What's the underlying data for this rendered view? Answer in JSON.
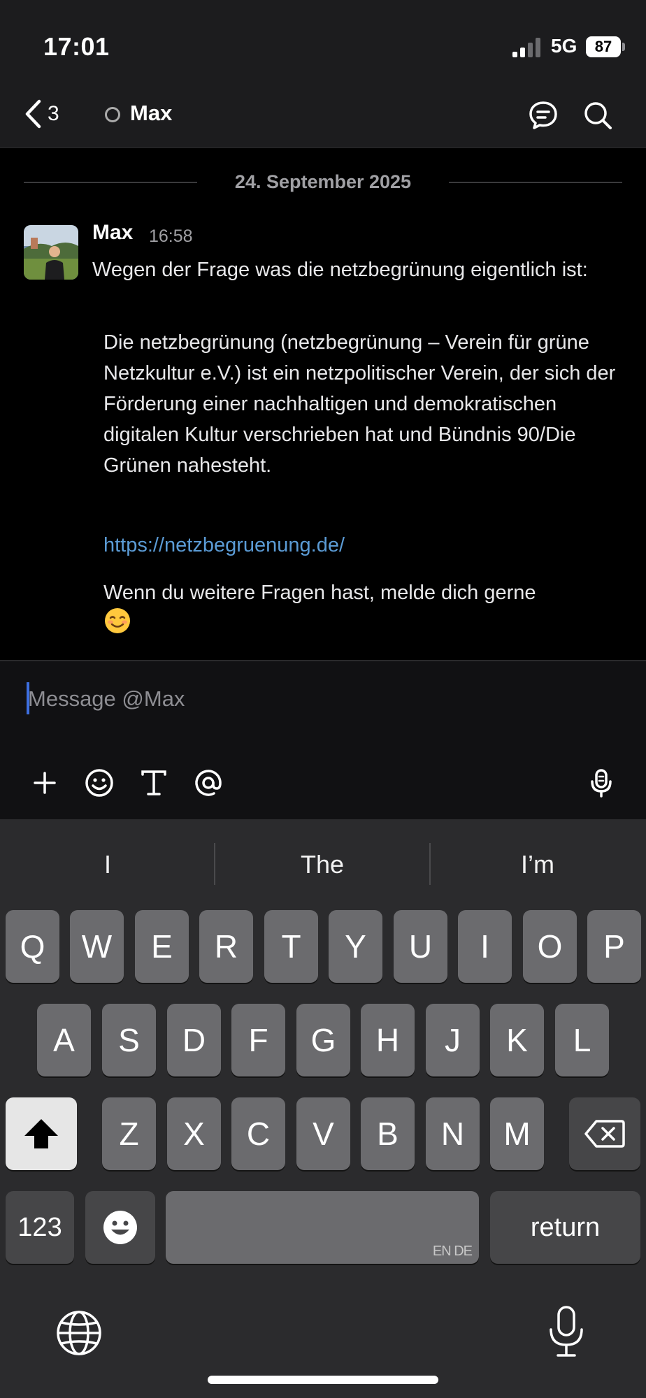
{
  "status_bar": {
    "time": "17:01",
    "network": "5G",
    "battery": "87"
  },
  "header": {
    "back_count": "3",
    "channel_name": "Max"
  },
  "messages": {
    "date_separator": "24. September 2025",
    "post": {
      "author": "Max",
      "time": "16:58",
      "text": "Wegen der Frage was die netzbegrünung eigentlich ist:",
      "quote": "Die netzbegrünung (netzbegrünung – Verein für grüne Netzkultur e.V.) ist ein netzpolitischer Verein, der sich der Förderung einer nachhaltigen und demokratischen digitalen Kultur verschrieben hat und Bündnis 90/Die Grünen nahesteht.",
      "link": "https://netzbegruenung.de/",
      "followup": "Wenn du weitere Fragen hast, melde dich gerne",
      "emoji": "☺️"
    }
  },
  "composer": {
    "placeholder": "Message @Max",
    "value": "",
    "tools": [
      "plus-icon",
      "emoji-icon",
      "text-format-icon",
      "at-mention-icon",
      "microphone-icon"
    ]
  },
  "keyboard": {
    "suggestions": [
      "I",
      "The",
      "I’m"
    ],
    "row1": [
      "Q",
      "W",
      "E",
      "R",
      "T",
      "Y",
      "U",
      "I",
      "O",
      "P"
    ],
    "row2": [
      "A",
      "S",
      "D",
      "F",
      "G",
      "H",
      "J",
      "K",
      "L"
    ],
    "row3": [
      "Z",
      "X",
      "C",
      "V",
      "B",
      "N",
      "M"
    ],
    "numbers_label": "123",
    "space_languages": "EN DE",
    "return_label": "return"
  }
}
